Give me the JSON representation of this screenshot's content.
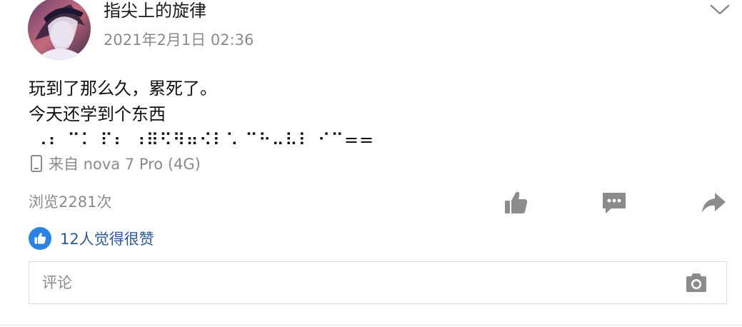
{
  "post": {
    "author": "指尖上的旋律",
    "time": "2021年2月1日 02:36",
    "content_lines": [
      "玩到了那么久，累死了。",
      "今天还学到个东西",
      " ⠠⠆ ⠉⠅ ⠏⠆ ⠰⠿⠫⠻⠶⠪⠇⠡ ⠉⠓⠤⠧⠇ ⠊⠉=="
    ],
    "device_text": "来自 nova 7 Pro (4G)",
    "views": "浏览2281次",
    "likes_text": "12人觉得很赞"
  },
  "comment": {
    "placeholder": "评论"
  },
  "icons": {
    "menu": "chevron-down-icon",
    "device": "phone-icon",
    "like": "thumbs-up-icon",
    "comment": "comment-icon",
    "share": "share-icon",
    "likes_badge": "thumbs-up-icon",
    "camera": "camera-icon"
  },
  "colors": {
    "icon_gray": "#8c8c8c",
    "likes_blue": "#2a82e4",
    "likes_text": "#2b5a97",
    "meta_gray": "#8a8a8a"
  }
}
